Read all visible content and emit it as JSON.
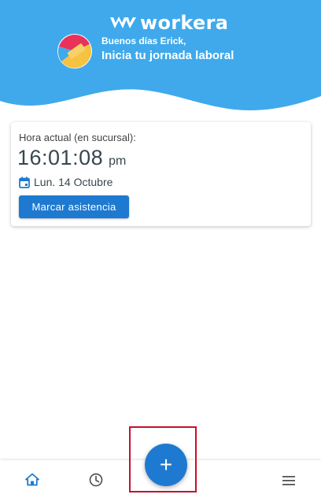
{
  "header": {
    "logo_text": "workera",
    "greeting": "Buenos días Erick,",
    "subtitle": "Inicia tu jornada laboral",
    "bg_color": "#3fa9ec"
  },
  "card": {
    "label": "Hora actual (en sucursal):",
    "time": "16:01:08",
    "ampm": "pm",
    "date": "Lun. 14 Octubre",
    "button_label": "Marcar asistencia",
    "calendar_icon": "calendar-icon"
  },
  "fab": {
    "label": "+",
    "icon": "plus-icon",
    "color": "#1e7ad0"
  },
  "bottom_nav": {
    "items": [
      {
        "icon": "home-icon"
      },
      {
        "icon": "clock-icon"
      },
      {
        "icon": "menu-icon"
      }
    ]
  }
}
